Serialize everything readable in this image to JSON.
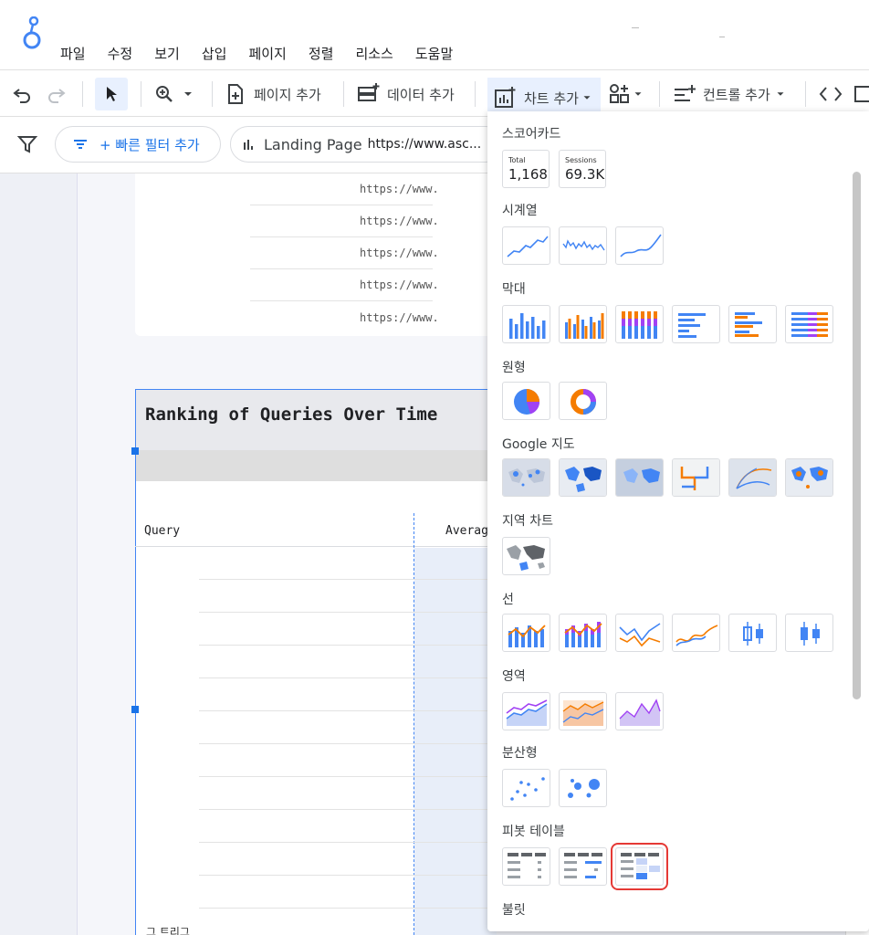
{
  "menu": {
    "items": [
      "파일",
      "수정",
      "보기",
      "삽입",
      "페이지",
      "정렬",
      "리소스",
      "도움말"
    ]
  },
  "toolbar": {
    "add_page": "페이지 추가",
    "add_data": "데이터 추가",
    "add_chart": "차트 추가",
    "add_control": "컨트롤 추가"
  },
  "filterbar": {
    "quick_filter": "+ 빠른 필터 추가",
    "chip_label": "Landing Page",
    "chip_value": "https://www.asc..."
  },
  "canvas": {
    "url_cells": [
      "https://www.",
      "https://www.",
      "https://www.",
      "https://www.",
      "https://www."
    ],
    "rank_title": "Ranking of Queries Over Time",
    "col_query": "Query",
    "col_average": "Averag",
    "bottom_text": "그 트리그"
  },
  "panel": {
    "sections": {
      "scorecard": "스코어카드",
      "timeseries": "시계열",
      "bar": "막대",
      "pie": "원형",
      "google_maps": "Google 지도",
      "geo": "지역 차트",
      "line": "선",
      "area": "영역",
      "scatter": "분산형",
      "pivot": "피봇 테이블",
      "bullet": "불릿"
    },
    "scorecards": [
      {
        "label": "Total",
        "value": "1,168"
      },
      {
        "label": "Sessions",
        "value": "69.3K"
      }
    ]
  },
  "colors": {
    "blue": "#4285f4",
    "orange": "#f57c00",
    "purple": "#a142f4",
    "selection": "#e53935"
  }
}
